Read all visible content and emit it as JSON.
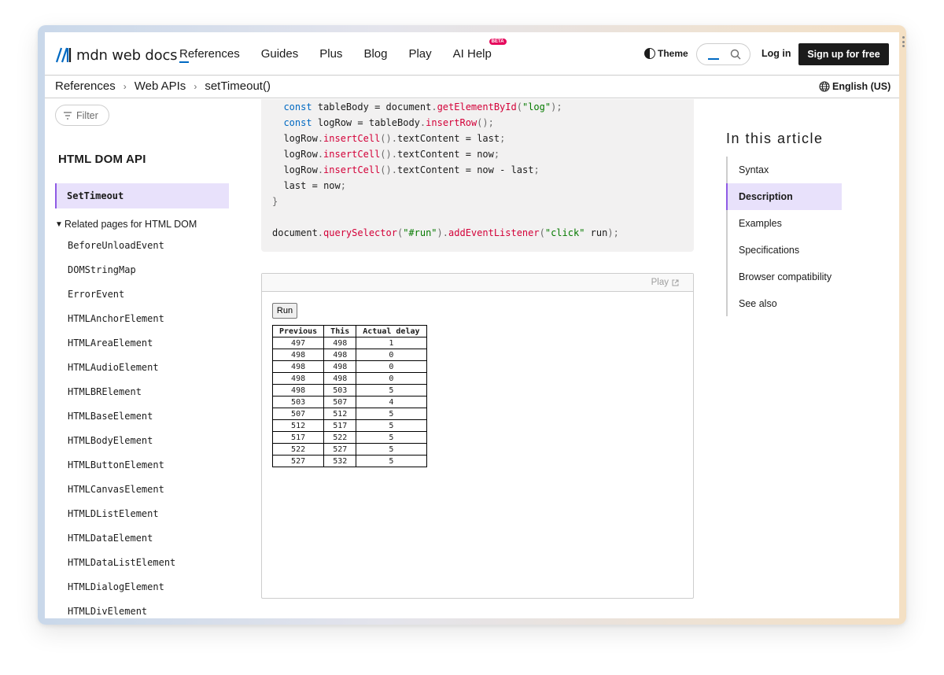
{
  "header": {
    "logo_text": "mdn web docs",
    "nav": [
      "References",
      "Guides",
      "Plus",
      "Blog",
      "Play",
      "AI Help"
    ],
    "beta_badge": "BETA",
    "theme_label": "Theme",
    "login_label": "Log in",
    "signup_label": "Sign up for free"
  },
  "breadcrumb": [
    "References",
    "Web APIs",
    "setTimeout()"
  ],
  "language": "English (US)",
  "sidebar": {
    "filter_placeholder": "Filter",
    "title": "HTML DOM API",
    "active_item": "SetTimeout",
    "related_label": "Related pages for HTML DOM",
    "items": [
      "BeforeUnloadEvent",
      "DOMStringMap",
      "ErrorEvent",
      "HTMLAnchorElement",
      "HTMLAreaElement",
      "HTMLAudioElement",
      "HTMLBRElement",
      "HTMLBaseElement",
      "HTMLBodyElement",
      "HTMLButtonElement",
      "HTMLCanvasElement",
      "HTMLDListElement",
      "HTMLDataElement",
      "HTMLDataListElement",
      "HTMLDialogElement",
      "HTMLDivElement"
    ]
  },
  "code": {
    "lines": [
      "  const tableBody = document.getElementById(\"log\");",
      "  const logRow = tableBody.insertRow();",
      "  logRow.insertCell().textContent = last;",
      "  logRow.insertCell().textContent = now;",
      "  logRow.insertCell().textContent = now - last;",
      "  last = now;",
      "}",
      "",
      "document.querySelector(\"#run\").addEventListener(\"click\", run);"
    ]
  },
  "sample": {
    "play_label": "Play",
    "run_label": "Run",
    "table": {
      "headers": [
        "Previous",
        "This",
        "Actual delay"
      ],
      "rows": [
        [
          "497",
          "498",
          "1"
        ],
        [
          "498",
          "498",
          "0"
        ],
        [
          "498",
          "498",
          "0"
        ],
        [
          "498",
          "498",
          "0"
        ],
        [
          "498",
          "503",
          "5"
        ],
        [
          "503",
          "507",
          "4"
        ],
        [
          "507",
          "512",
          "5"
        ],
        [
          "512",
          "517",
          "5"
        ],
        [
          "517",
          "522",
          "5"
        ],
        [
          "522",
          "527",
          "5"
        ],
        [
          "527",
          "532",
          "5"
        ]
      ]
    }
  },
  "toc": {
    "title": "In this article",
    "items": [
      "Syntax",
      "Description",
      "Examples",
      "Specifications",
      "Browser compatibility",
      "See also"
    ],
    "active": "Description"
  },
  "colors": {
    "accent_purple": "#8f5be5",
    "active_bg": "#e8e1fb",
    "link_blue": "#0069c2",
    "signup_bg": "#1b1b1b"
  },
  "icons": [
    "mdn-logo-icon",
    "theme-icon",
    "search-icon",
    "globe-icon",
    "filter-icon",
    "external-link-icon",
    "chevron-right-icon",
    "disclosure-triangle-icon"
  ]
}
